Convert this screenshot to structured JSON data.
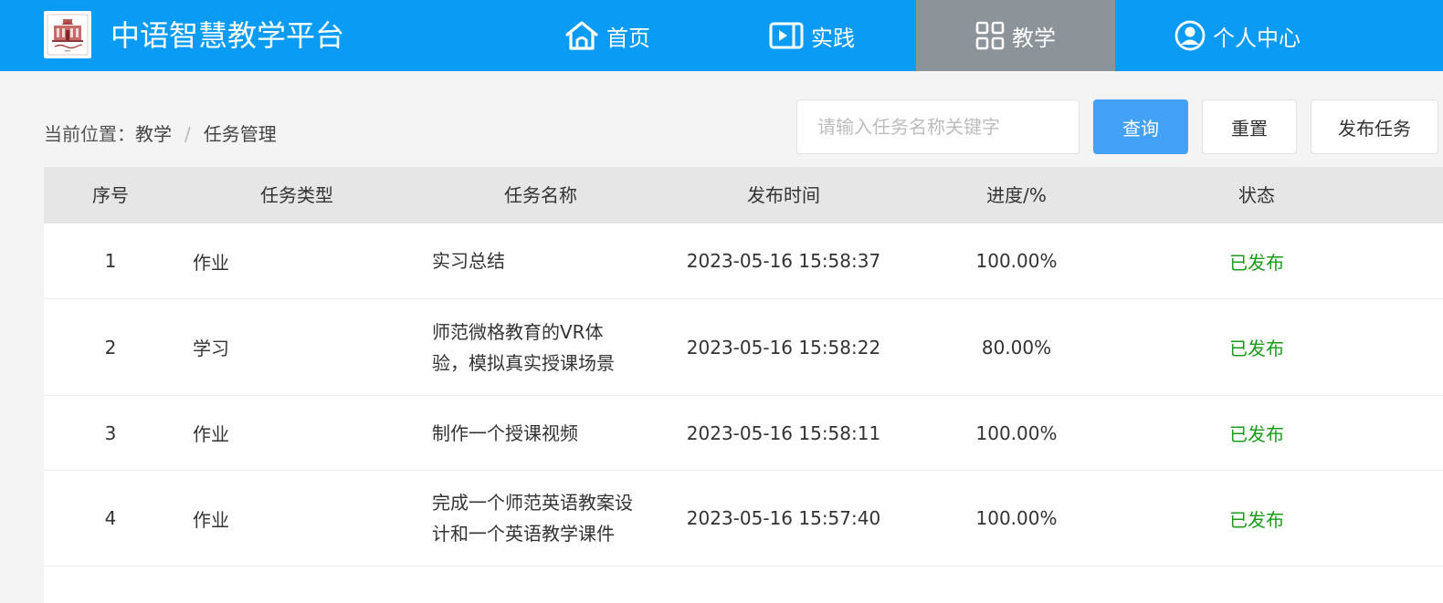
{
  "header": {
    "title": "中语智慧教学平台",
    "accent_color": "#0a9cf5",
    "active_tab_color": "#8c9399",
    "nav": [
      {
        "label": "首页",
        "icon": "home-icon"
      },
      {
        "label": "实践",
        "icon": "video-icon"
      },
      {
        "label": "教学",
        "icon": "grid-icon",
        "active": true
      },
      {
        "label": "个人中心",
        "icon": "user-circle-icon"
      }
    ]
  },
  "breadcrumb": {
    "prefix": "当前位置：",
    "items": [
      "教学",
      "任务管理"
    ],
    "separator": "/"
  },
  "toolbar": {
    "search_placeholder": "请输入任务名称关键字",
    "search_value": "",
    "query_label": "查询",
    "reset_label": "重置",
    "publish_label": "发布任务"
  },
  "table": {
    "columns": [
      "序号",
      "任务类型",
      "任务名称",
      "发布时间",
      "进度/%",
      "状态"
    ],
    "rows": [
      {
        "no": "1",
        "type": "作业",
        "name": "实习总结",
        "time": "2023-05-16 15:58:37",
        "progress": "100.00%",
        "status": "已发布"
      },
      {
        "no": "2",
        "type": "学习",
        "name": "师范微格教育的VR体验，模拟真实授课场景",
        "time": "2023-05-16 15:58:22",
        "progress": "80.00%",
        "status": "已发布"
      },
      {
        "no": "3",
        "type": "作业",
        "name": "制作一个授课视频",
        "time": "2023-05-16 15:58:11",
        "progress": "100.00%",
        "status": "已发布"
      },
      {
        "no": "4",
        "type": "作业",
        "name": "完成一个师范英语教案设计和一个英语教学课件",
        "time": "2023-05-16 15:57:40",
        "progress": "100.00%",
        "status": "已发布"
      }
    ]
  },
  "colors": {
    "status_published": "#1a9c1a",
    "primary_button": "#43a1f7"
  }
}
